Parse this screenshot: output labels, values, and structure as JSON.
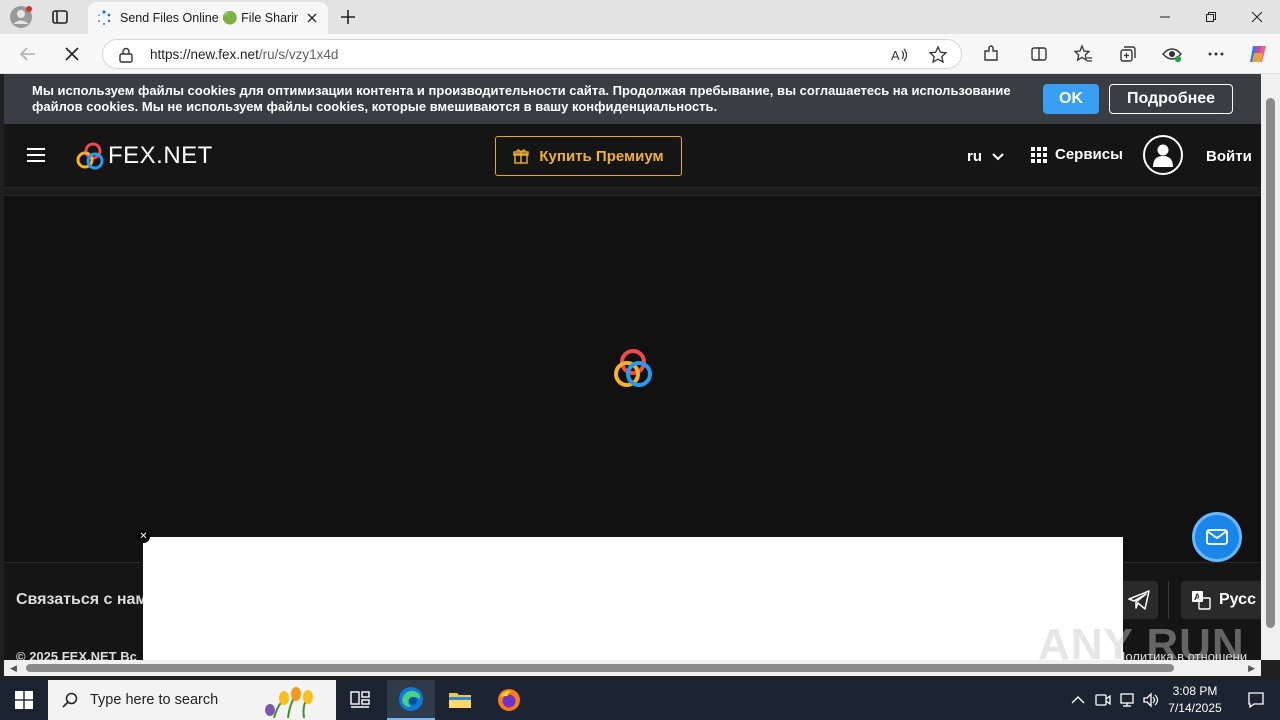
{
  "browser": {
    "tab_title": "Send Files Online 🟢 File Sharing",
    "url_host": "https://new.fex.net",
    "url_path": "/ru/s/vzy1x4d"
  },
  "cookie_banner": {
    "text": "Мы используем файлы cookies для оптимизации контента и производительности сайта. Продолжая пребывание, вы соглашаетесь на использование файлов cookies. Мы не используем файлы cookies, которые вмешиваются в вашу конфиденциальность.",
    "ok_label": "OK",
    "more_label": "Подробнее"
  },
  "header": {
    "logo_text": "FEX.NET",
    "premium_label": "Купить Премиум",
    "lang_label": "ru",
    "services_label": "Сервисы",
    "login_label": "Войти"
  },
  "footer": {
    "contact_label": "Связаться с нам",
    "lang_select": "Русс",
    "copyright": "© 2025 FEX.NET Вс",
    "policy": "Политика в отношени"
  },
  "watermark": "ANY RUN",
  "taskbar": {
    "search_placeholder": "Type here to search",
    "time": "3:08 PM",
    "date": "7/14/2025"
  },
  "colors": {
    "accent_blue": "#3a9ef5",
    "premium_gold": "#f0b232",
    "page_bg": "#111111"
  }
}
